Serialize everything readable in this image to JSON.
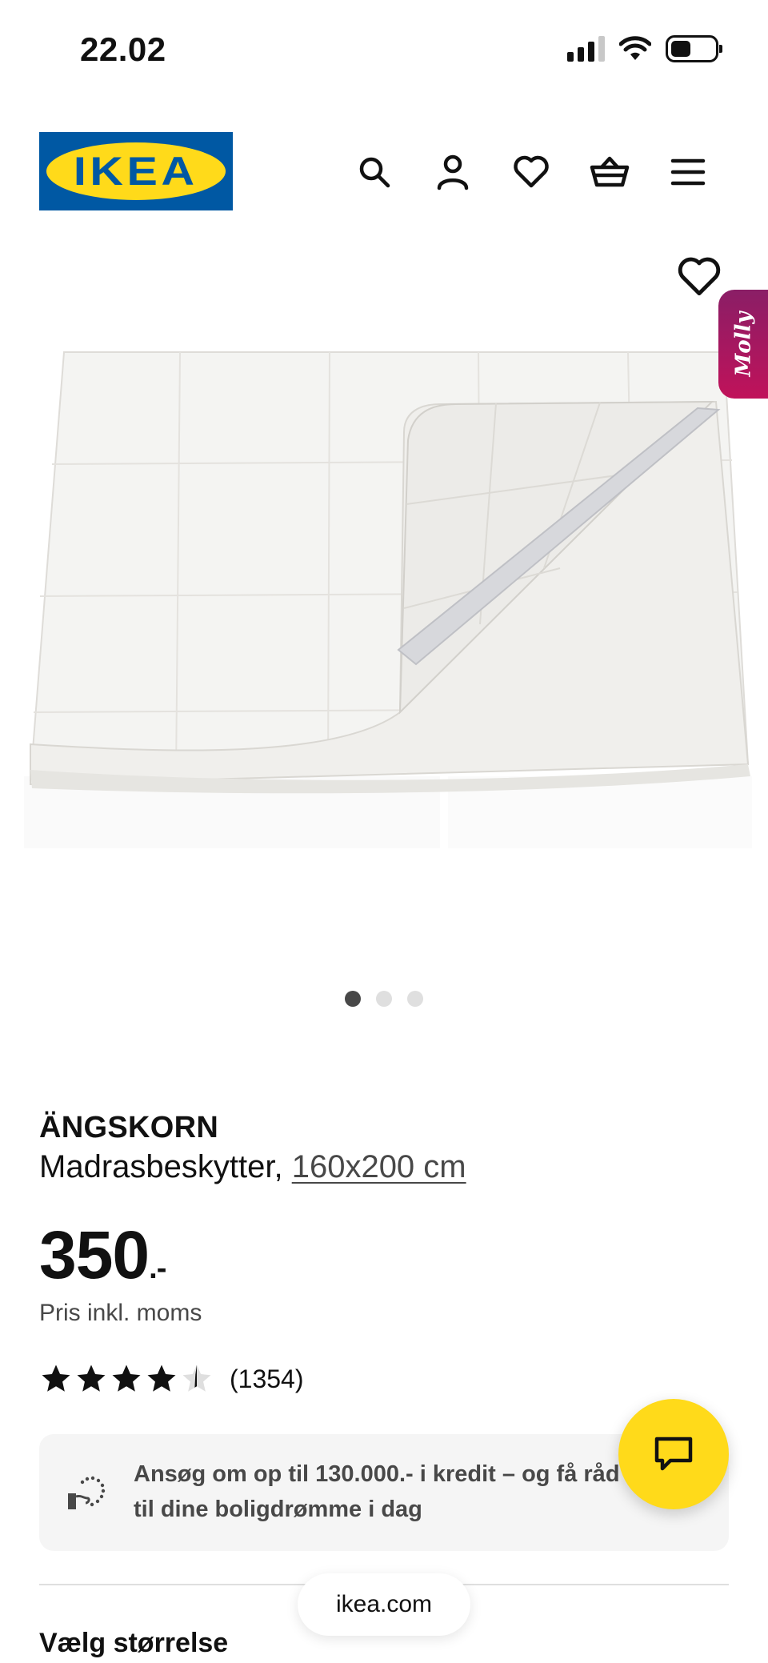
{
  "status_bar": {
    "time": "22.02"
  },
  "header": {
    "logo_text": "IKEA",
    "icons": [
      "search-icon",
      "account-icon",
      "heart-icon",
      "basket-icon",
      "menu-icon"
    ]
  },
  "gallery": {
    "molly_label": "Molly",
    "slide_count": 3,
    "active_slide": 1
  },
  "product": {
    "name": "ÄNGSKORN",
    "description": "Madrasbeskytter,",
    "size": "160x200 cm",
    "price": "350",
    "price_suffix": ".-",
    "vat_note": "Pris inkl. moms",
    "rating": 4.5,
    "rating_count": "(1354)"
  },
  "credit_banner": {
    "text": "Ansøg om op til 130.000.- i kredit – og få råd til dine boligdrømme i dag"
  },
  "browser": {
    "url": "ikea.com"
  },
  "size_section": {
    "title": "Vælg størrelse"
  },
  "colors": {
    "ikea_blue": "#0058a3",
    "ikea_yellow": "#ffda1a",
    "molly_magenta": "#b0155e"
  }
}
